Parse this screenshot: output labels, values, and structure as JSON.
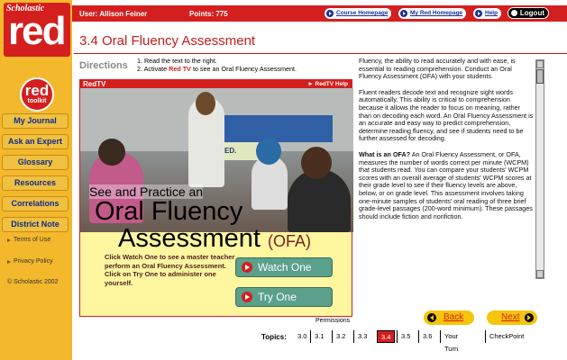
{
  "brand": {
    "publisher": "Scholastic",
    "logo": "red",
    "toolkit_top": "red",
    "toolkit_bottom": "toolkit"
  },
  "colors": {
    "brand_red": "#d41f1f",
    "sidebar_gold": "#f3b82c",
    "nav_blue": "#0d2b8f",
    "video_yellow": "#fff6a0"
  },
  "header": {
    "user": "User: Allison Feiner",
    "points": "Points: 775",
    "buttons": [
      "Course Homepage",
      "My Red Homepage",
      "Help"
    ],
    "logout": "Logout"
  },
  "sidebar": {
    "items": [
      "My Journal",
      "Ask an Expert",
      "Glossary",
      "Resources",
      "Correlations",
      "District Note"
    ],
    "links": [
      "Terms of Use",
      "Privacy Policy"
    ],
    "copyright": "Scholastic 2002"
  },
  "page": {
    "title": "3.4 Oral Fluency Assessment",
    "directions_label": "Directions",
    "directions": [
      "1. Read the text to the right.",
      "2. Activate",
      "Red TV",
      "to see an Oral Fluency Assessment."
    ]
  },
  "video": {
    "header": "RedTV",
    "help": "RedTV Help",
    "see": "See and Practice an",
    "oral": "Oral Fluency",
    "assessment": "Assessment",
    "ofa": "(OFA)",
    "board_text": "SUCCEED.",
    "instructions": "Click Watch One to see a master teacher perform an Oral Fluency Assessment. Click on Try One to administer one yourself.",
    "watch": "Watch One",
    "try": "Try One"
  },
  "panel": {
    "p1": "Fluency, the ability to read accurately and with ease, is essential to reading comprehension. Conduct an Oral Fluency Assessment (OFA) with your students.",
    "p2": "Fluent readers decode text and recognize sight words automatically. This ability is critical to comprehension because it allows the reader to focus on meaning, rather than on decoding each word. An Oral Fluency Assessment is an accurate and easy way to predict comprehension, determine reading fluency, and see if students need to be further assessed for decoding.",
    "p3_head": "What is an OFA?",
    "p3": "An Oral Fluency Assessment, or OFA, measures the number of words correct per minute (WCPM) that students read. You can compare your students' WCPM scores with an overall average of students' WCPM scores at their grade level to see if their fluency levels are above, below, or on grade level. This assessment involves taking one-minute samples of students' oral reading of three brief grade-level passages (200-word minimum). These passages should include fiction and nonfiction."
  },
  "footer": {
    "permissions": "Permissions",
    "back": "Back",
    "next": "Next",
    "topics_label": "Topics:",
    "topics": [
      "3.0",
      "3.1",
      "3.2",
      "3.3",
      "3.4",
      "3.5",
      "3.6",
      "Your Turn",
      "CheckPoint"
    ],
    "active_topic": "3.4"
  }
}
